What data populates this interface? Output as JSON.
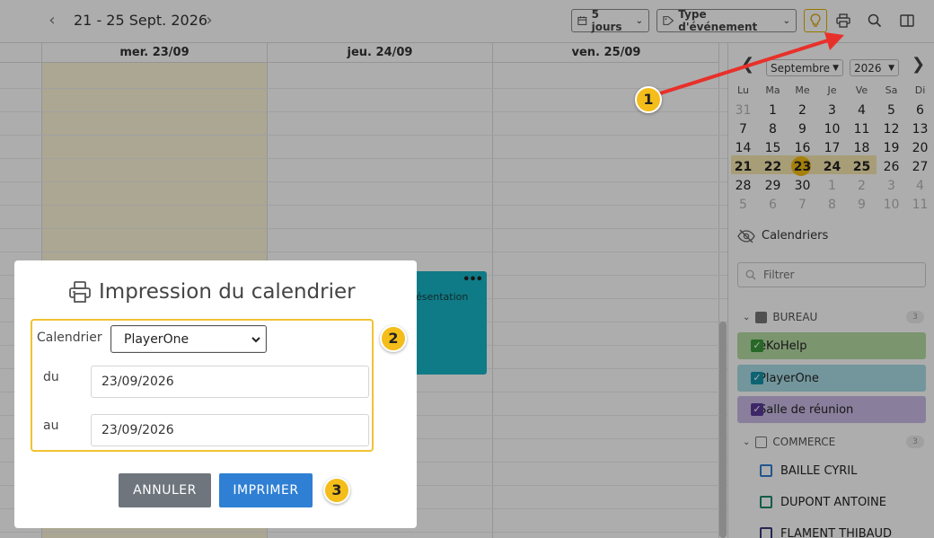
{
  "toolbar": {
    "week_range": "21 - 25 Sept. 2026",
    "view_label": "5 jours",
    "event_type_label": "Type d'événement"
  },
  "calendar": {
    "columns": [
      "mer. 23/09",
      "jeu. 24/09",
      "ven. 25/09"
    ],
    "event_text": "ésentation"
  },
  "mini_calendar": {
    "month": "Septembre",
    "year": "2026",
    "weekdays": [
      "Lu",
      "Ma",
      "Me",
      "Je",
      "Ve",
      "Sa",
      "Di"
    ],
    "weeks": [
      [
        "31",
        "1",
        "2",
        "3",
        "4",
        "5",
        "6"
      ],
      [
        "7",
        "8",
        "9",
        "10",
        "11",
        "12",
        "13"
      ],
      [
        "14",
        "15",
        "16",
        "17",
        "18",
        "19",
        "20"
      ],
      [
        "21",
        "22",
        "23",
        "24",
        "25",
        "26",
        "27"
      ],
      [
        "28",
        "29",
        "30",
        "1",
        "2",
        "3",
        "4"
      ],
      [
        "5",
        "6",
        "7",
        "8",
        "9",
        "10",
        "11"
      ]
    ]
  },
  "calendars_panel": {
    "title": "Calendriers",
    "filter_placeholder": "Filtrer",
    "group_bureau": "BUREAU",
    "group_bureau_count": "3",
    "bureau_items": [
      "eKoHelp",
      "PlayerOne",
      "Salle de réunion"
    ],
    "group_commerce": "COMMERCE",
    "group_commerce_count": "3",
    "commerce_items": [
      "BAILLE CYRIL",
      "DUPONT ANTOINE",
      "FLAMENT THIBAUD"
    ]
  },
  "dialog": {
    "title": "Impression du calendrier",
    "calendar_label": "Calendrier",
    "calendar_value": "PlayerOne",
    "from_label": "du",
    "from_value": "23/09/2026",
    "to_label": "au",
    "to_value": "23/09/2026",
    "cancel_label": "ANNULER",
    "print_label": "IMPRIMER"
  },
  "markers": [
    "1",
    "2",
    "3"
  ],
  "colors": {
    "accent_yellow": "#f4bd1a",
    "print_button": "#2f7fd4",
    "cancel_button": "#6e757d",
    "event_teal": "#17b6c6",
    "ekohelp": "#b6dca4",
    "playerone": "#a8dee6",
    "salle": "#cbbbe6",
    "arrow_red": "#e8302a"
  }
}
